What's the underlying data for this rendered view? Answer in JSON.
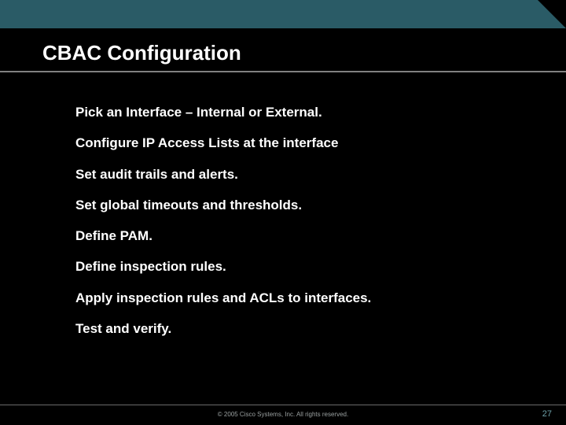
{
  "slide": {
    "title": "CBAC Configuration",
    "bullets": [
      "Pick an Interface – Internal or External.",
      "Configure IP Access Lists at the interface",
      "Set audit trails and alerts.",
      "Set global timeouts and thresholds.",
      "Define PAM.",
      "Define inspection rules.",
      "Apply inspection rules and ACLs to interfaces.",
      "Test and verify."
    ],
    "footer": {
      "copyright": "© 2005 Cisco Systems, Inc. All rights reserved.",
      "page_number": "27"
    }
  }
}
